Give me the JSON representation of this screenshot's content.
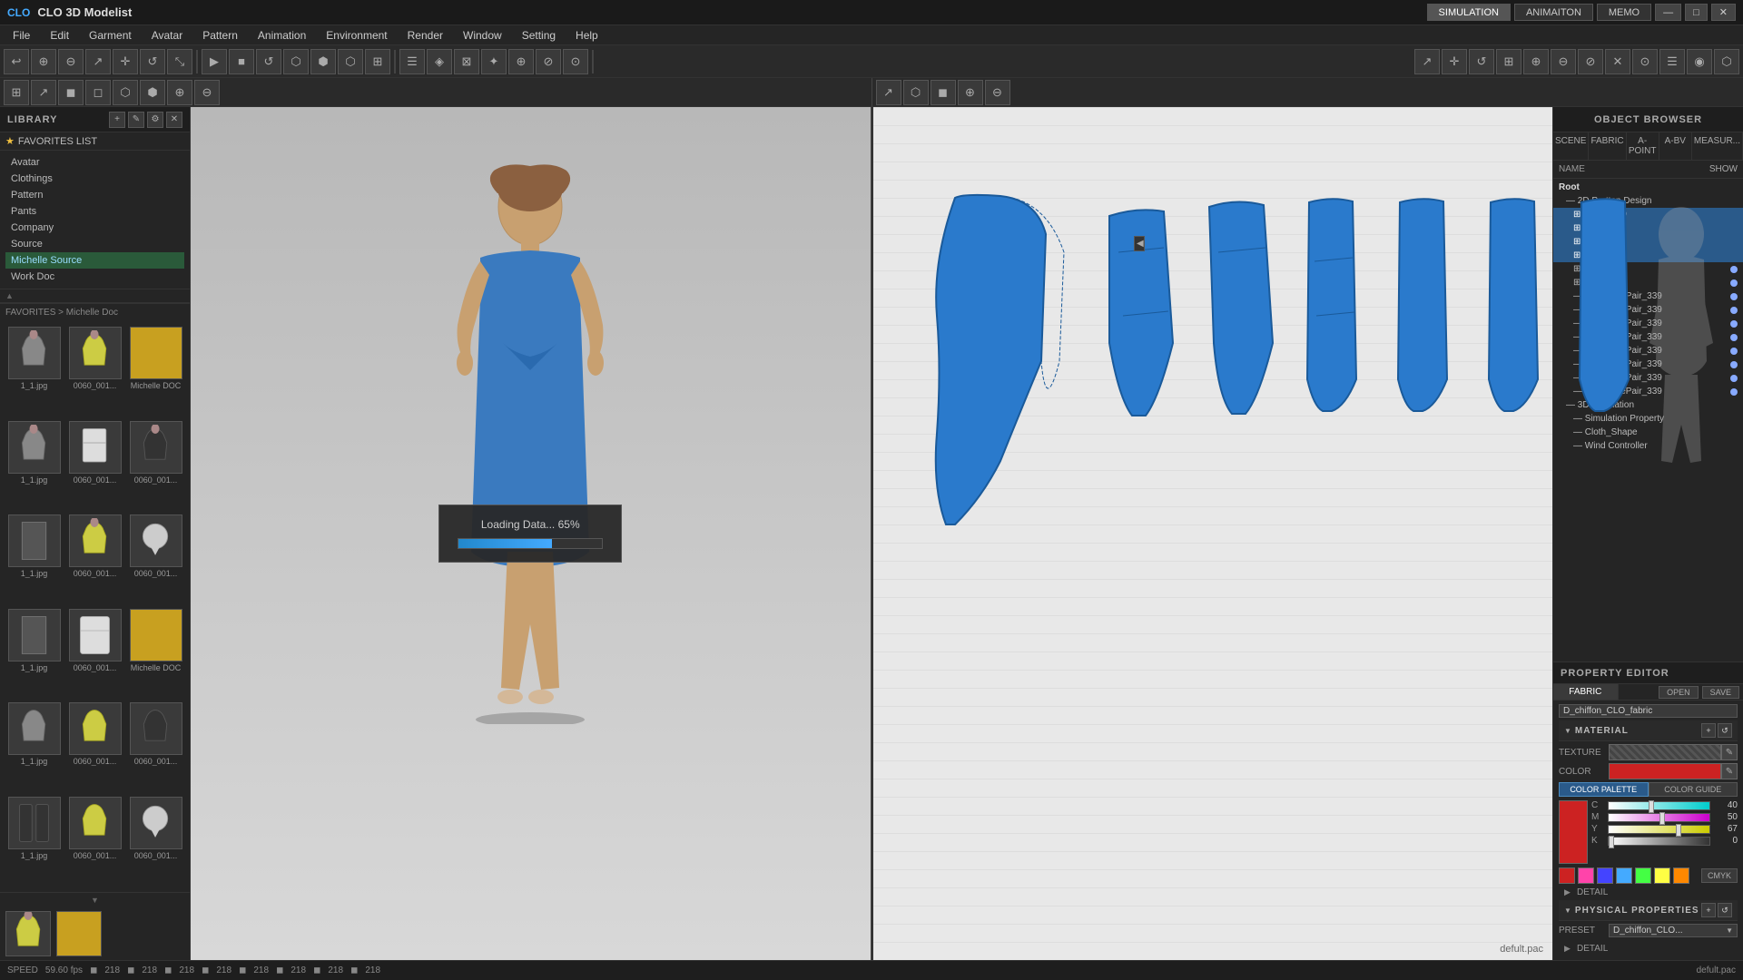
{
  "app": {
    "title": "CLO 3D Modelist",
    "logo": "CLO"
  },
  "topbar": {
    "tabs": [
      {
        "label": "SIMULATION",
        "active": true
      },
      {
        "label": "ANIMAITON",
        "active": false
      },
      {
        "label": "MEMO",
        "active": false
      }
    ],
    "win_buttons": [
      "—",
      "□",
      "✕"
    ]
  },
  "menu": {
    "items": [
      "File",
      "Edit",
      "Garment",
      "Avatar",
      "Pattern",
      "Animation",
      "Environment",
      "Render",
      "Window",
      "Setting",
      "Help"
    ]
  },
  "left_panel": {
    "title": "LIBRARY",
    "nav_items": [
      {
        "label": "Avatar",
        "active": false
      },
      {
        "label": "Clothings",
        "active": false
      },
      {
        "label": "Pattern",
        "active": false
      },
      {
        "label": "Pants",
        "active": false
      },
      {
        "label": "Company",
        "active": false
      },
      {
        "label": "Source",
        "active": false
      },
      {
        "label": "Michelle Source",
        "active": true,
        "highlighted": true
      },
      {
        "label": "Work Doc",
        "active": false
      }
    ],
    "breadcrumb": "FAVORITES > Michelle Doc",
    "thumbnails": [
      {
        "label": "1_1.jpg"
      },
      {
        "label": "0060_001..."
      },
      {
        "label": "Michelle DOC"
      },
      {
        "label": "1_1.jpg"
      },
      {
        "label": "0060_001..."
      },
      {
        "label": "0060_001..."
      },
      {
        "label": "1_1.jpg"
      },
      {
        "label": "0060_001..."
      },
      {
        "label": "0060_001..."
      },
      {
        "label": "1_1.jpg"
      },
      {
        "label": "0060_001..."
      },
      {
        "label": "0060_001..."
      },
      {
        "label": "1_1.jpg"
      },
      {
        "label": "0060_001..."
      },
      {
        "label": "Michelle DOC"
      },
      {
        "label": "1_1.jpg"
      },
      {
        "label": "0060_001..."
      },
      {
        "label": "0060_001..."
      }
    ]
  },
  "viewport_3d": {
    "label": ""
  },
  "viewport_2d": {
    "label": "defult.pac"
  },
  "loading": {
    "text": "Loading Data... 65%",
    "progress": 65
  },
  "status_bar": {
    "speed_label": "SPEED",
    "speed_value": "59.60 fps",
    "coords": [
      "218",
      "218",
      "218",
      "218",
      "218",
      "218",
      "218",
      "218"
    ]
  },
  "right_panel": {
    "title": "OBJECT BROWSER",
    "tabs": [
      "SCENE",
      "FABRIC",
      "A-POINT",
      "A-BV",
      "MEASUR..."
    ],
    "name_label": "NAME",
    "show_label": "SHOW",
    "tree": [
      {
        "label": "Root",
        "level": 0,
        "indent": 0
      },
      {
        "label": "2D Partten Design",
        "level": 1,
        "indent": 1
      },
      {
        "label": "Pattern 2D",
        "level": 2,
        "indent": 2,
        "selected": true
      },
      {
        "label": "Pattern 2D",
        "level": 2,
        "indent": 2,
        "selected": true
      },
      {
        "label": "Pattern 2D",
        "level": 2,
        "indent": 2,
        "selected": true
      },
      {
        "label": "Pattern 2D",
        "level": 2,
        "indent": 2,
        "selected": true
      },
      {
        "label": "Pattern 2D",
        "level": 2,
        "indent": 2,
        "bullet": true
      },
      {
        "label": "Pattern 2D",
        "level": 2,
        "indent": 2,
        "bullet": true
      },
      {
        "label": "SeamLinePair_339",
        "level": 2,
        "indent": 2,
        "bullet": true
      },
      {
        "label": "SeamLinePair_339",
        "level": 2,
        "indent": 2,
        "bullet": true
      },
      {
        "label": "SeamLinePair_339",
        "level": 2,
        "indent": 2,
        "bullet": true
      },
      {
        "label": "SeamLinePair_339",
        "level": 2,
        "indent": 2,
        "bullet": true
      },
      {
        "label": "SeamLinePair_339",
        "level": 2,
        "indent": 2,
        "bullet": true
      },
      {
        "label": "SeamLinePair_339",
        "level": 2,
        "indent": 2,
        "bullet": true
      },
      {
        "label": "SeamLinePair_339",
        "level": 2,
        "indent": 2,
        "bullet": true
      },
      {
        "label": "SeamLinePair_339",
        "level": 2,
        "indent": 2,
        "bullet": true
      },
      {
        "label": "3D Simulation",
        "level": 1,
        "indent": 1
      },
      {
        "label": "Simulation Property",
        "level": 2,
        "indent": 2
      },
      {
        "label": "Cloth_Shape",
        "level": 2,
        "indent": 2
      },
      {
        "label": "Wind Controller",
        "level": 2,
        "indent": 2
      }
    ]
  },
  "property_editor": {
    "title": "PROPERTY EDITOR",
    "tabs": [
      "FABRIC",
      "OPEN",
      "SAVE"
    ],
    "fabric_name": "D_chiffon_CLO_fabric",
    "sections": {
      "material": {
        "title": "MATERIAL",
        "texture_label": "TEXTURE",
        "color_label": "COLOR",
        "color_palette_label": "COLOR PALETTE",
        "color_guide_label": "COLOR GUIDE"
      },
      "cmyk": {
        "channels": [
          {
            "label": "C",
            "value": "40",
            "color_start": "#fff",
            "color_end": "#00aacc"
          },
          {
            "label": "M",
            "value": "50",
            "color_start": "#fff",
            "color_end": "#cc0088"
          },
          {
            "label": "Y",
            "value": "67",
            "color_start": "#fff",
            "color_end": "#cccc00"
          },
          {
            "label": "K",
            "value": "0",
            "color_start": "#fff",
            "color_end": "#000"
          }
        ]
      },
      "swatches": [
        "#cc2222",
        "#ff44aa",
        "#4444ff",
        "#44aaff",
        "#44ff44",
        "#ffff44",
        "#ff8800"
      ],
      "detail": {
        "label": "DETAIL"
      },
      "physical": {
        "title": "PHYSICAL PROPERTIES",
        "preset_label": "PRESET",
        "preset_value": "D_chiffon_CLO...",
        "detail_label": "DETAIL"
      }
    }
  }
}
